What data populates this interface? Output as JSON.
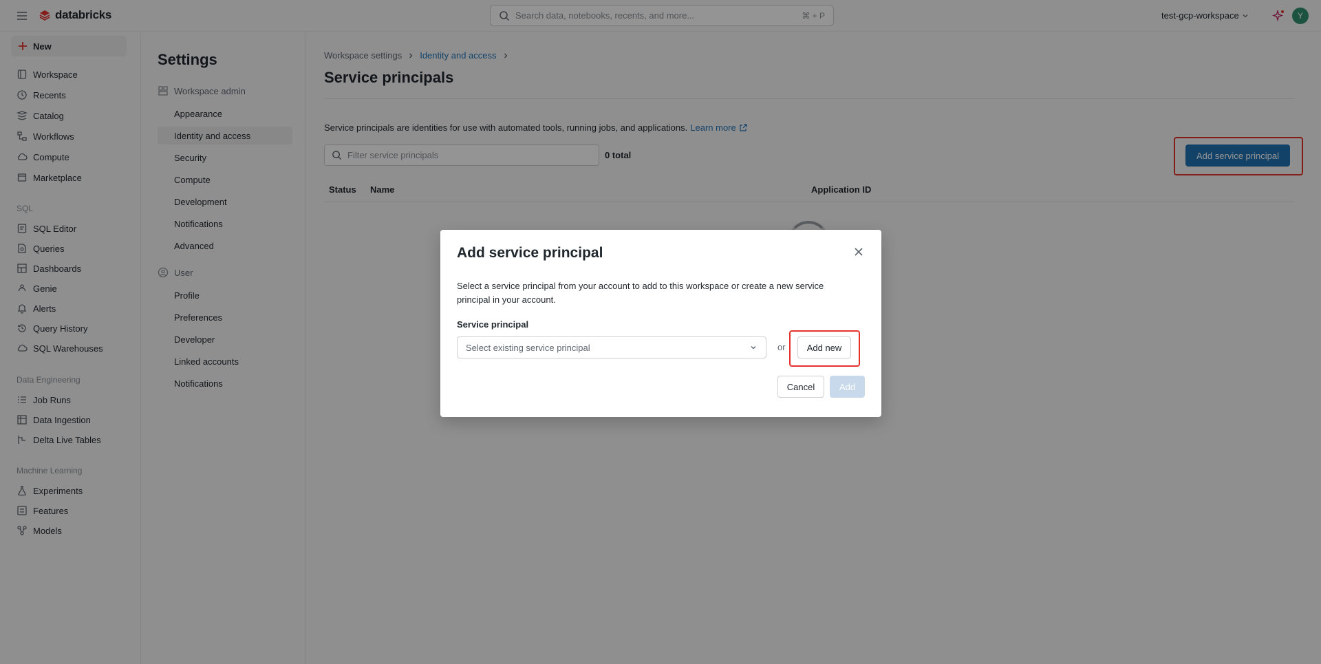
{
  "topbar": {
    "brand": "databricks",
    "search_placeholder": "Search data, notebooks, recents, and more...",
    "search_shortcut": "⌘ + P",
    "workspace": "test-gcp-workspace",
    "avatar_initial": "Y"
  },
  "leftnav": {
    "new_label": "New",
    "main_items": [
      "Workspace",
      "Recents",
      "Catalog",
      "Workflows",
      "Compute",
      "Marketplace"
    ],
    "sql_section": "SQL",
    "sql_items": [
      "SQL Editor",
      "Queries",
      "Dashboards",
      "Genie",
      "Alerts",
      "Query History",
      "SQL Warehouses"
    ],
    "de_section": "Data Engineering",
    "de_items": [
      "Job Runs",
      "Data Ingestion",
      "Delta Live Tables"
    ],
    "ml_section": "Machine Learning",
    "ml_items": [
      "Experiments",
      "Features",
      "Models"
    ]
  },
  "settings": {
    "title": "Settings",
    "workspace_admin": "Workspace admin",
    "admin_items": [
      "Appearance",
      "Identity and access",
      "Security",
      "Compute",
      "Development",
      "Notifications",
      "Advanced"
    ],
    "user_group": "User",
    "user_items": [
      "Profile",
      "Preferences",
      "Developer",
      "Linked accounts",
      "Notifications"
    ]
  },
  "main": {
    "breadcrumb_root": "Workspace settings",
    "breadcrumb_current": "Identity and access",
    "title": "Service principals",
    "description": "Service principals are identities for use with automated tools, running jobs, and applications.",
    "learn_more": "Learn more",
    "filter_placeholder": "Filter service principals",
    "total": "0 total",
    "add_button": "Add service principal",
    "columns": [
      "Status",
      "Name",
      "Application ID"
    ]
  },
  "modal": {
    "title": "Add service principal",
    "description": "Select a service principal from your account to add to this workspace or create a new service principal in your account.",
    "field_label": "Service principal",
    "select_placeholder": "Select existing service principal",
    "or": "or",
    "add_new": "Add new",
    "cancel": "Cancel",
    "add": "Add"
  }
}
